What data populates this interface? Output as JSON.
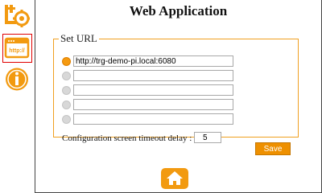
{
  "app": {
    "title": "Web Application"
  },
  "sidebar": {
    "items": [
      {
        "icon": "settings-network-icon",
        "active": false
      },
      {
        "icon": "url-browser-icon",
        "label": "http://",
        "active": true
      },
      {
        "icon": "info-icon",
        "active": false
      }
    ]
  },
  "url_section": {
    "legend": "Set URL",
    "urls": [
      {
        "value": "http://trg-demo-pi.local:6080",
        "selected": true
      },
      {
        "value": "",
        "selected": false
      },
      {
        "value": "",
        "selected": false
      },
      {
        "value": "",
        "selected": false
      },
      {
        "value": "",
        "selected": false
      }
    ]
  },
  "timeout": {
    "label": "Configuration screen timeout delay :",
    "value": "5"
  },
  "actions": {
    "save_label": "Save"
  },
  "footer": {
    "home_icon": "home-icon"
  },
  "colors": {
    "accent": "#f29a10",
    "active_border": "#e00000",
    "frame": "#444444"
  }
}
